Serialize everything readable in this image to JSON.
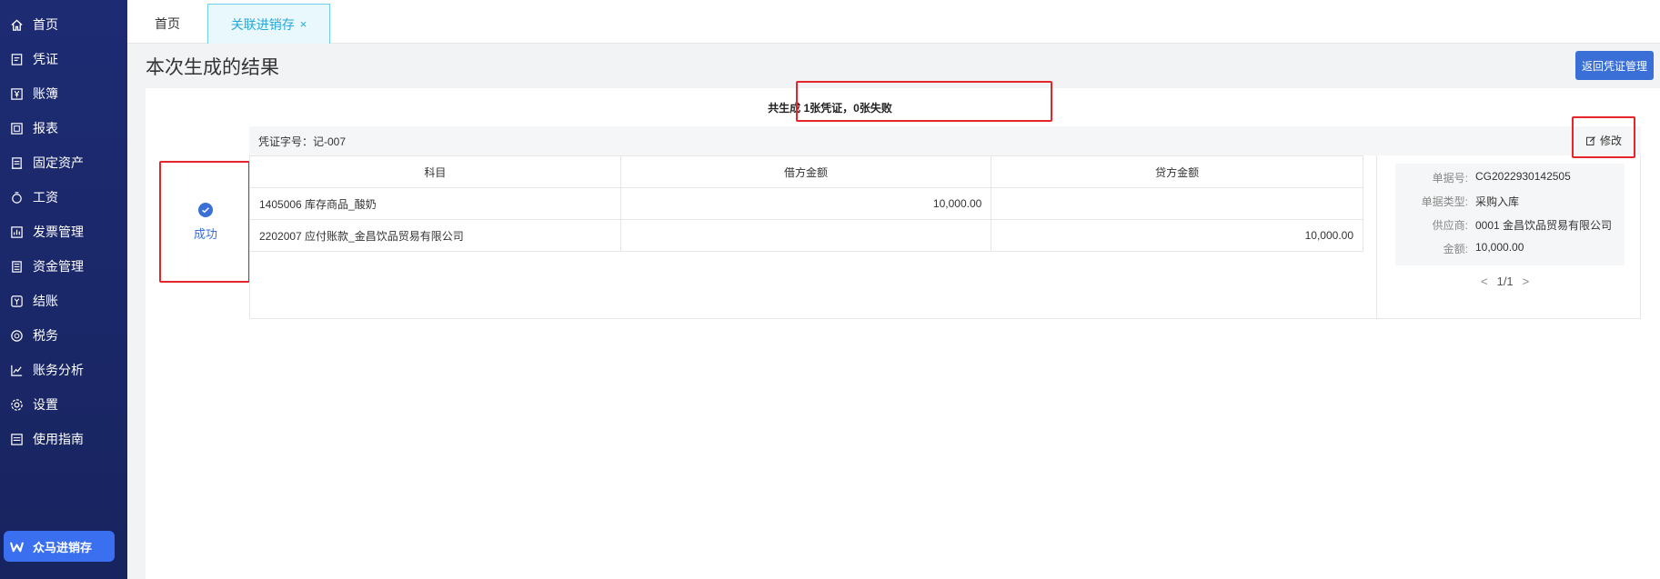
{
  "sidebar": {
    "items": [
      {
        "label": "首页",
        "icon": "home-icon"
      },
      {
        "label": "凭证",
        "icon": "voucher-icon"
      },
      {
        "label": "账簿",
        "icon": "yen-icon"
      },
      {
        "label": "报表",
        "icon": "report-icon"
      },
      {
        "label": "固定资产",
        "icon": "asset-icon"
      },
      {
        "label": "工资",
        "icon": "salary-icon"
      },
      {
        "label": "发票管理",
        "icon": "invoice-icon"
      },
      {
        "label": "资金管理",
        "icon": "fund-icon"
      },
      {
        "label": "结账",
        "icon": "closing-icon"
      },
      {
        "label": "税务",
        "icon": "tax-icon"
      },
      {
        "label": "账务分析",
        "icon": "chart-icon"
      },
      {
        "label": "设置",
        "icon": "gear-icon"
      },
      {
        "label": "使用指南",
        "icon": "guide-icon"
      }
    ],
    "brand_label": "众马进销存"
  },
  "tabs": {
    "home": "首页",
    "active": "关联进销存",
    "close_glyph": "×"
  },
  "header": {
    "title": "本次生成的结果",
    "back_button": "返回凭证管理"
  },
  "summary": "共生成 1张凭证，0张失败",
  "status": "成功",
  "voucher": {
    "number_label": "凭证字号：记-007",
    "edit_label": "修改",
    "columns": [
      "科目",
      "借方金额",
      "贷方金额"
    ],
    "rows": [
      {
        "subject": "1405006 库存商品_酸奶",
        "debit": "10,000.00",
        "credit": ""
      },
      {
        "subject": "2202007 应付账款_金昌饮品贸易有限公司",
        "debit": "",
        "credit": "10,000.00"
      }
    ]
  },
  "document": {
    "fields": [
      {
        "key": "单据号:",
        "value": "CG2022930142505"
      },
      {
        "key": "单据类型:",
        "value": "采购入库"
      },
      {
        "key": "供应商:",
        "value": "0001 金昌饮品贸易有限公司"
      },
      {
        "key": "金额:",
        "value": "10,000.00"
      }
    ],
    "pager_prev": "<",
    "pager_text": "1/1",
    "pager_next": ">"
  },
  "colors": {
    "sidebar_bg": "#1d2b73",
    "brand_active": "#3a6ff0",
    "accent": "#3b6fd8",
    "tab_active": "#27a8d8",
    "highlight_box": "#e5252a"
  }
}
